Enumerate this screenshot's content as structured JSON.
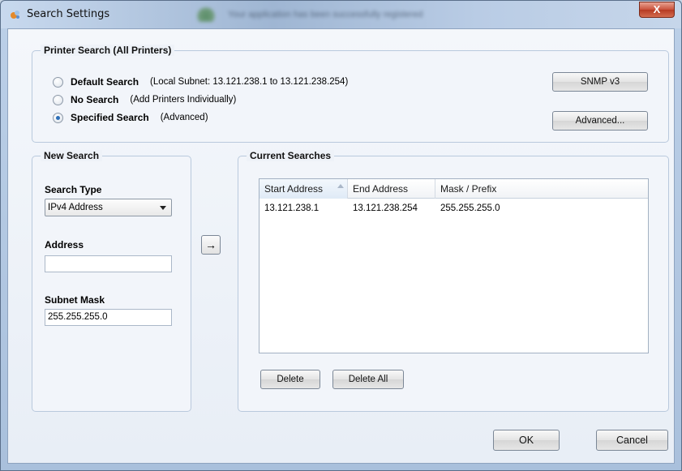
{
  "window": {
    "title": "Search Settings",
    "banner": "Your application has been successfully registered",
    "close_label": "X"
  },
  "printer_search": {
    "title": "Printer Search (All Printers)",
    "options": [
      {
        "label": "Default Search",
        "desc": "(Local Subnet: 13.121.238.1 to 13.121.238.254)",
        "selected": false
      },
      {
        "label": "No Search",
        "desc": "(Add Printers Individually)",
        "selected": false
      },
      {
        "label": "Specified Search",
        "desc": "(Advanced)",
        "selected": true
      }
    ],
    "snmp_label": "SNMP v3",
    "advanced_label": "Advanced..."
  },
  "new_search": {
    "title": "New Search",
    "search_type_label": "Search Type",
    "search_type_value": "IPv4 Address",
    "address_label": "Address",
    "address_value": "",
    "subnet_label": "Subnet Mask",
    "subnet_value": "255.255.255.0",
    "add_arrow": "→"
  },
  "current_searches": {
    "title": "Current Searches",
    "columns": [
      "Start Address",
      "End Address",
      "Mask / Prefix"
    ],
    "rows": [
      [
        "13.121.238.1",
        "13.121.238.254",
        "255.255.255.0"
      ]
    ],
    "delete_label": "Delete",
    "delete_all_label": "Delete All"
  },
  "footer": {
    "ok_label": "OK",
    "cancel_label": "Cancel"
  }
}
